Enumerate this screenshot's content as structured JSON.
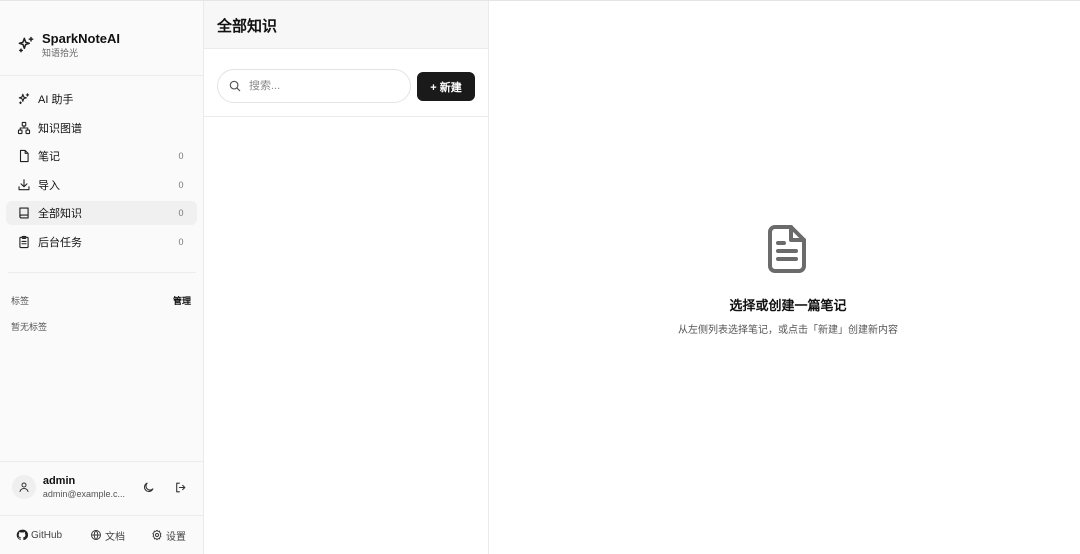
{
  "brand": {
    "name": "SparkNoteAI",
    "subtitle": "知语拾光",
    "icon": "sparkles-icon"
  },
  "nav": {
    "items": [
      {
        "label": "AI 助手",
        "icon": "sparkles-icon",
        "count": "",
        "active": false
      },
      {
        "label": "知识图谱",
        "icon": "network-icon",
        "count": "",
        "active": false
      },
      {
        "label": "笔记",
        "icon": "file-icon",
        "count": "0",
        "active": false
      },
      {
        "label": "导入",
        "icon": "download-icon",
        "count": "0",
        "active": false
      },
      {
        "label": "全部知识",
        "icon": "book-icon",
        "count": "0",
        "active": true
      },
      {
        "label": "后台任务",
        "icon": "clipboard-icon",
        "count": "0",
        "active": false
      }
    ]
  },
  "tags": {
    "title": "标签",
    "manage_label": "管理",
    "empty_text": "暂无标签"
  },
  "user": {
    "name": "admin",
    "email": "admin@example.c..."
  },
  "footer": {
    "github_label": "GitHub",
    "docs_label": "文档",
    "settings_label": "设置"
  },
  "list": {
    "title": "全部知识",
    "search_placeholder": "搜索...",
    "new_button_label": "+ 新建"
  },
  "empty_state": {
    "title": "选择或创建一篇笔记",
    "description": "从左侧列表选择笔记，或点击「新建」创建新内容"
  },
  "colors": {
    "accent_dark": "#1a1a1a",
    "sidebar_bg": "#fafafa",
    "active_bg": "#f0f0f0",
    "empty_icon": "#6b6b6b"
  }
}
